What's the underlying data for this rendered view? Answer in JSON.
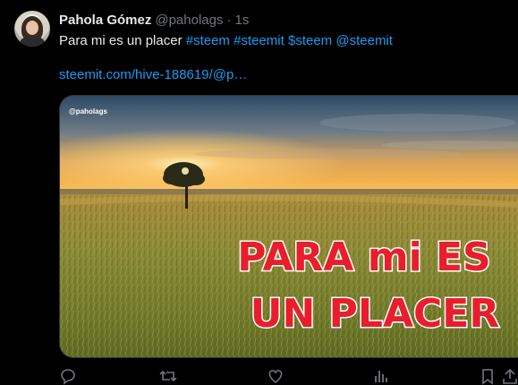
{
  "tweet": {
    "author_name": "Pahola Gómez",
    "author_handle": "@paholags",
    "separator": "·",
    "time": "1s",
    "text_plain": "Para mi es un placer ",
    "tags": [
      "#steem",
      "#steemit",
      "$steem",
      "@steemit"
    ],
    "link": "steemit.com/hive-188619/@p…"
  },
  "media": {
    "watermark": "@paholags",
    "overlay_line1": "PARA mi ES",
    "overlay_line2": "UN PLACER"
  },
  "actions": [
    "reply-icon",
    "retweet-icon",
    "like-icon",
    "views-icon",
    "bookmark-icon",
    "share-icon"
  ],
  "colors": {
    "background": "#000000",
    "text": "#e7e9ea",
    "muted": "#71767b",
    "accent": "#1d9bf0",
    "overlay_text": "#e81e2c"
  }
}
